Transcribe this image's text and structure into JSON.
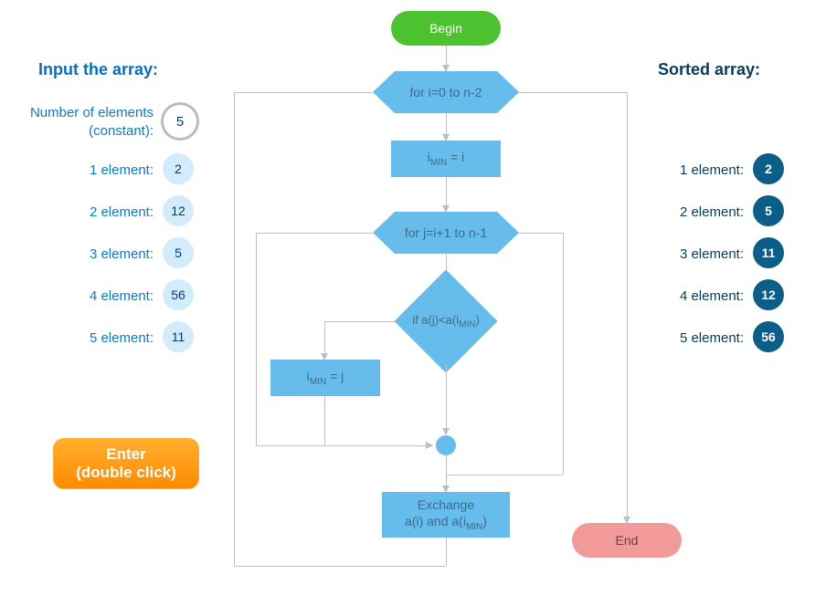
{
  "input_panel": {
    "title": "Input the array:",
    "constant_label": "Number of elements\n(constant):",
    "constant_value": "5",
    "elements": [
      {
        "label": "1 element:",
        "value": "2"
      },
      {
        "label": "2 element:",
        "value": "12"
      },
      {
        "label": "3 element:",
        "value": "5"
      },
      {
        "label": "4 element:",
        "value": "56"
      },
      {
        "label": "5 element:",
        "value": "11"
      }
    ],
    "enter_label_line1": "Enter",
    "enter_label_line2": "(double click)"
  },
  "sorted_panel": {
    "title": "Sorted array:",
    "elements": [
      {
        "label": "1 element:",
        "value": "2"
      },
      {
        "label": "2 element:",
        "value": "5"
      },
      {
        "label": "3 element:",
        "value": "11"
      },
      {
        "label": "4 element:",
        "value": "12"
      },
      {
        "label": "5 element:",
        "value": "56"
      }
    ]
  },
  "flow": {
    "begin": "Begin",
    "outer_loop": "for i=0 to n-2",
    "init_min_pre": "i",
    "init_min_sub": "MIN",
    "init_min_post": " = i",
    "inner_loop": "for j=i+1 to n-1",
    "cond_pre": "if a(j)<a(i",
    "cond_sub": "MIN",
    "cond_post": ")",
    "update_pre": "i",
    "update_sub": "MIN",
    "update_post": " = j",
    "exchange_line1": "Exchange",
    "exchange_line2_pre": "a(i) and a(i",
    "exchange_line2_sub": "MIN",
    "exchange_line2_post": ")",
    "end": "End"
  }
}
